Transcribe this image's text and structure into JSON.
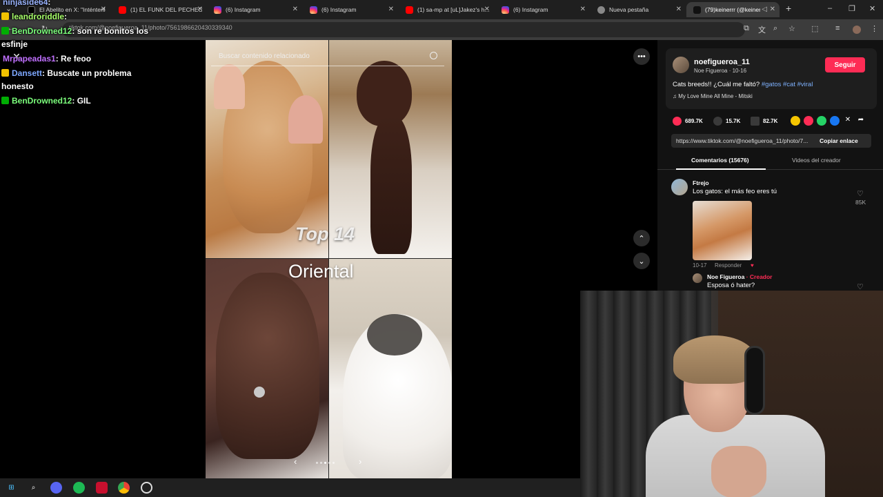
{
  "browser": {
    "tabs": [
      {
        "label": "El Abelito en X: \"Inténtenlo...",
        "type": "x"
      },
      {
        "label": "(1) EL FUNK DEL PECHEO",
        "type": "yt"
      },
      {
        "label": "(6) Instagram",
        "type": "ig"
      },
      {
        "label": "(6) Instagram",
        "type": "ig"
      },
      {
        "label": "(1) sa-mp at [uL]Jakez's h...",
        "type": "yt"
      },
      {
        "label": "(6) Instagram",
        "type": "ig"
      },
      {
        "label": "Nueva pestaña",
        "type": "chrome"
      },
      {
        "label": "(79)keinerrr (@keinerrr...",
        "type": "tt"
      }
    ],
    "new_tab": "+",
    "url": "tiktok.com/@noefigueroa_11/photo/7561986620430339340"
  },
  "chat": [
    {
      "user": "ninjaside64",
      "msg": ":",
      "color": "#9ab4ff",
      "badge": "none"
    },
    {
      "user": "leandroriddle",
      "msg": ":",
      "color": "#a8ff6a",
      "badge": "crown"
    },
    {
      "user": "BenDrowned12",
      "msg": ": son re bonitos los",
      "color": "#7cff7c",
      "badge": "mod"
    },
    {
      "user": "",
      "msg": "esfinje",
      "color": "#ffffff",
      "badge": "none"
    },
    {
      "user": "Mrpapeadas1",
      "msg": ": Re feoo",
      "color": "#c070ff",
      "badge": "none"
    },
    {
      "user": "Dansett",
      "msg": ": Buscate un problema",
      "color": "#7ea8ff",
      "badge": "crown"
    },
    {
      "user": "",
      "msg": "honesto",
      "color": "#ffffff",
      "badge": "none"
    },
    {
      "user": "BenDrowned12",
      "msg": ": GIL",
      "color": "#7cff7c",
      "badge": "mod"
    }
  ],
  "post": {
    "search_placeholder": "Buscar contenido relacionado",
    "overlay_top": "Top 14",
    "overlay_oriental": "Oriental",
    "username": "noefigueroa_11",
    "display_name": "Noe Figueroa · 10-16",
    "follow_label": "Seguir",
    "caption": "Cats breeds!! ¿Cuál me faltó?",
    "hashtags": "#gatos #cat #viral",
    "music": "My Love Mine All Mine - Mitski",
    "likes": "689.7K",
    "comments": "15.7K",
    "saves": "82.7K",
    "link": "https://www.tiktok.com/@noefigueroa_11/photo/7...",
    "copy_label": "Copiar enlace",
    "tab_comments": "Comentarios (15676)",
    "tab_videos": "Videos del creador"
  },
  "comments": [
    {
      "author": "Ftrejo",
      "text": "Los gatos: el más feo eres tú",
      "likes": "85K",
      "date": "10-17",
      "reply": "Responder"
    },
    {
      "author": "Noe Figueroa",
      "creator_tag": "Creador",
      "text": "Esposa ó hater?"
    }
  ],
  "colors": {
    "accent": "#fe2c55",
    "hashtag": "#7fb2ff",
    "panel_bg": "#121212"
  }
}
